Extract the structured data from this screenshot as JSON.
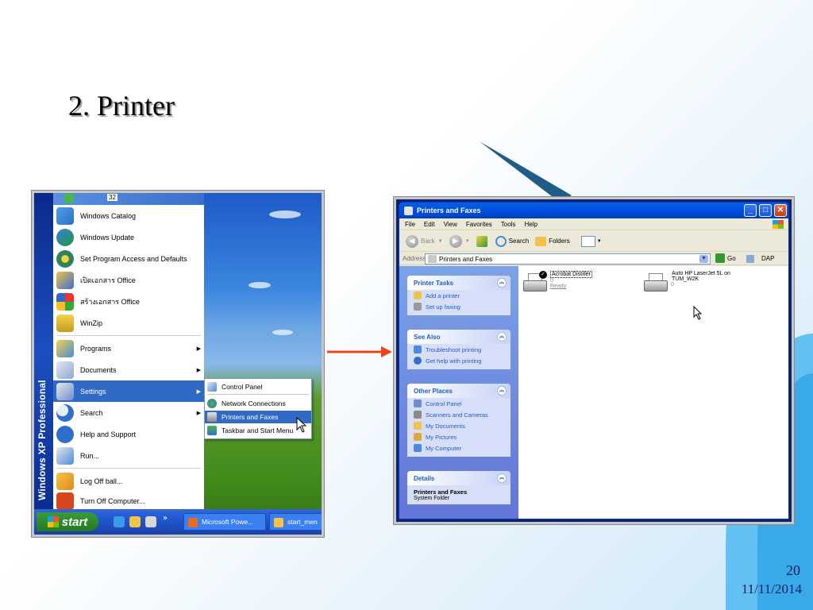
{
  "slide": {
    "title": "2. Printer",
    "page_number": "20",
    "date": "11/11/2014"
  },
  "start_menu": {
    "brand": "Windows XP Professional",
    "top_items": [
      {
        "label": "Windows Catalog",
        "icon": "globe-icon"
      },
      {
        "label": "Windows Update",
        "icon": "globe-update-icon"
      },
      {
        "label": "Set Program Access and Defaults",
        "icon": "program-access-icon"
      },
      {
        "label": "เปิดเอกสาร Office",
        "icon": "office-open-icon"
      },
      {
        "label": "สร้างเอกสาร Office",
        "icon": "office-new-icon"
      },
      {
        "label": "WinZip",
        "icon": "winzip-icon"
      }
    ],
    "mid_items": [
      {
        "label": "Programs",
        "icon": "programs-icon"
      },
      {
        "label": "Documents",
        "icon": "documents-icon"
      },
      {
        "label": "Settings",
        "icon": "settings-icon"
      },
      {
        "label": "Search",
        "icon": "search-icon"
      },
      {
        "label": "Help and Support",
        "icon": "help-icon"
      },
      {
        "label": "Run...",
        "icon": "run-icon"
      }
    ],
    "bottom_items": [
      {
        "label": "Log Off ball...",
        "icon": "logoff-icon"
      },
      {
        "label": "Turn Off Computer...",
        "icon": "power-icon"
      }
    ],
    "settings_submenu": [
      {
        "label": "Control Panel"
      },
      {
        "label": "Network Connections"
      },
      {
        "label": "Printers and Faxes"
      },
      {
        "label": "Taskbar and Start Menu"
      }
    ],
    "top_badge": "32"
  },
  "taskbar": {
    "start_label": "start",
    "chevron": "»",
    "tasks": [
      {
        "label": "Microsoft Powe..."
      },
      {
        "label": "start_men"
      }
    ]
  },
  "explorer": {
    "title": "Printers and Faxes",
    "menu": [
      "File",
      "Edit",
      "View",
      "Favorites",
      "Tools",
      "Help"
    ],
    "toolbar": {
      "back": "Back",
      "search": "Search",
      "folders": "Folders"
    },
    "address": {
      "label": "Address",
      "value": "Printers and Faxes",
      "go": "Go",
      "extra": "DAP"
    },
    "printer_tasks": {
      "title": "Printer Tasks",
      "items": [
        "Add a printer",
        "Set up faxing"
      ]
    },
    "see_also": {
      "title": "See Also",
      "items": [
        "Troubleshoot printing",
        "Get help with printing"
      ]
    },
    "other_places": {
      "title": "Other Places",
      "items": [
        "Control Panel",
        "Scanners and Cameras",
        "My Documents",
        "My Pictures",
        "My Computer"
      ]
    },
    "details": {
      "title": "Details",
      "name": "Printers and Faxes",
      "type": "System Folder"
    },
    "printers": [
      {
        "name": "Acrobat Distiller",
        "docs": "0",
        "status": "Ready"
      },
      {
        "name": "Auto HP LaserJet 5L on TUM_W2K",
        "docs": "0",
        "status": ""
      }
    ]
  }
}
